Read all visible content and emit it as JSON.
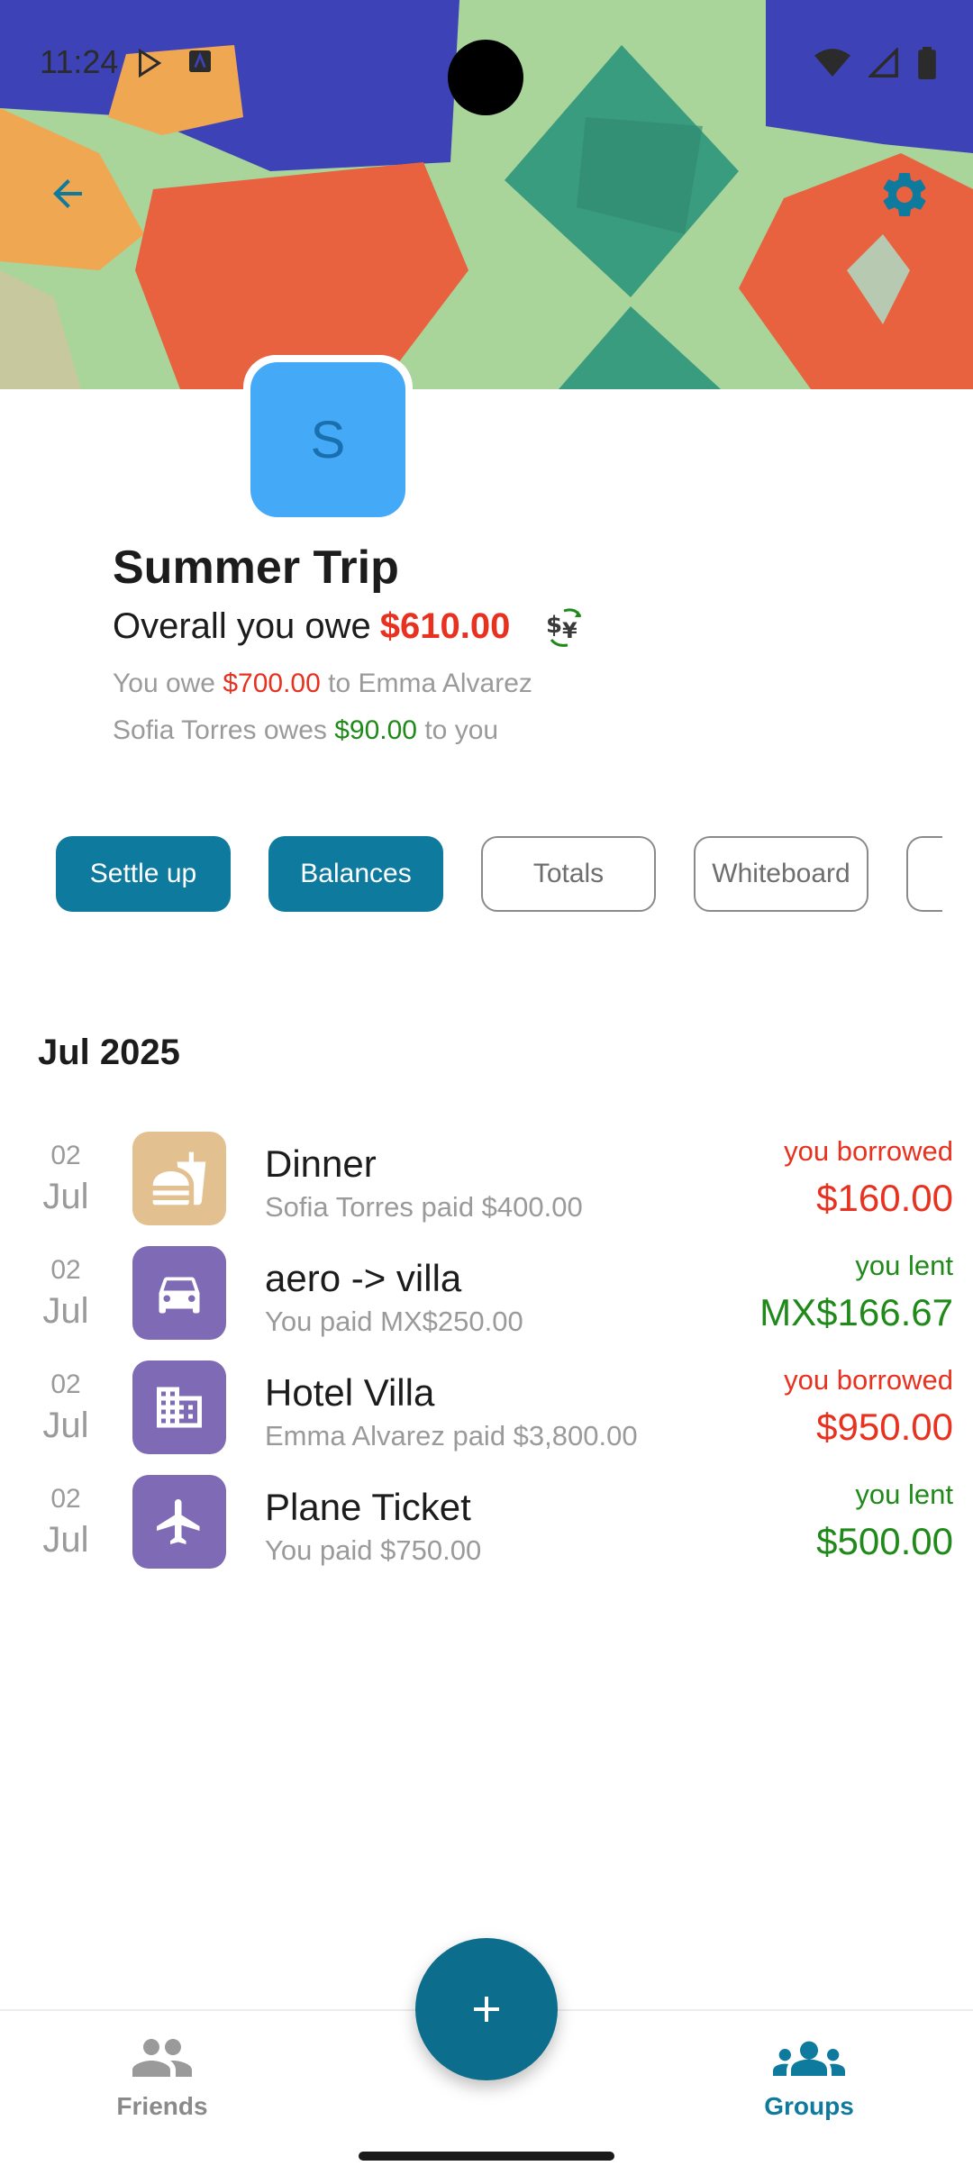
{
  "status_bar": {
    "time": "11:24"
  },
  "header": {
    "back_icon": "arrow-back-icon",
    "settings_icon": "gear-icon"
  },
  "group": {
    "avatar_letter": "S",
    "name": "Summer Trip",
    "overall_prefix": "Overall you owe",
    "overall_amount": "$610.00",
    "line1": {
      "prefix": "You owe",
      "amount": "$700.00",
      "suffix": "to Emma Alvarez"
    },
    "line2": {
      "prefix": "Sofia Torres owes",
      "amount": "$90.00",
      "suffix": "to you"
    }
  },
  "actions": [
    "Settle up",
    "Balances",
    "Totals",
    "Whiteboard"
  ],
  "section": {
    "month": "Jul 2025"
  },
  "expenses": [
    {
      "day": "02",
      "month": "Jul",
      "icon": "fastfood-icon",
      "title": "Dinner",
      "subtitle": "Sofia Torres paid $400.00",
      "status": "you borrowed",
      "amount": "$160.00"
    },
    {
      "day": "02",
      "month": "Jul",
      "icon": "car-icon",
      "title": "aero -> villa",
      "subtitle": "You paid MX$250.00",
      "status": "you lent",
      "amount": "MX$166.67"
    },
    {
      "day": "02",
      "month": "Jul",
      "icon": "building-icon",
      "title": "Hotel Villa",
      "subtitle": "Emma Alvarez paid $3,800.00",
      "status": "you borrowed",
      "amount": "$950.00"
    },
    {
      "day": "02",
      "month": "Jul",
      "icon": "airplane-icon",
      "title": "Plane Ticket",
      "subtitle": "You paid $750.00",
      "status": "you lent",
      "amount": "$500.00"
    }
  ],
  "bottom_nav": {
    "friends": "Friends",
    "groups": "Groups"
  },
  "colors": {
    "accent": "#0e7a9e",
    "owe": "#e8311f",
    "lent": "#1f8a19",
    "food": "#e3c08f",
    "transport": "#7f6bb5"
  }
}
